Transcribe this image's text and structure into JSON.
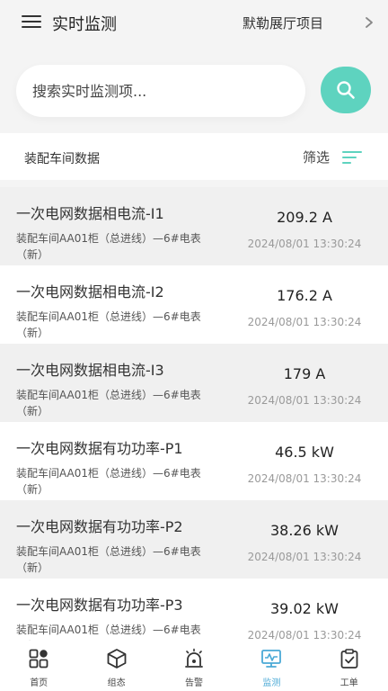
{
  "header": {
    "title": "实时监测",
    "project": "默勒展厅项目"
  },
  "search": {
    "placeholder": "搜索实时监测项..."
  },
  "section": {
    "title": "装配车间数据",
    "filter_label": "筛选"
  },
  "rows": [
    {
      "name": "一次电网数据相电流-I1",
      "location": "装配车间AA01柜（总进线）—6#电表（新）",
      "value": "209.2 A",
      "time": "2024/08/01 13:30:24"
    },
    {
      "name": "一次电网数据相电流-I2",
      "location": "装配车间AA01柜（总进线）—6#电表（新）",
      "value": "176.2 A",
      "time": "2024/08/01 13:30:24"
    },
    {
      "name": "一次电网数据相电流-I3",
      "location": "装配车间AA01柜（总进线）—6#电表（新）",
      "value": "179 A",
      "time": "2024/08/01 13:30:24"
    },
    {
      "name": "一次电网数据有功功率-P1",
      "location": "装配车间AA01柜（总进线）—6#电表（新）",
      "value": "46.5 kW",
      "time": "2024/08/01 13:30:24"
    },
    {
      "name": "一次电网数据有功功率-P2",
      "location": "装配车间AA01柜（总进线）—6#电表（新）",
      "value": "38.26 kW",
      "time": "2024/08/01 13:30:24"
    },
    {
      "name": "一次电网数据有功功率-P3",
      "location": "装配车间AA01柜（总进线）—6#电表（新）",
      "value": "39.02 kW",
      "time": "2024/08/01 13:30:24"
    }
  ],
  "tabs": [
    {
      "label": "首页",
      "icon": "home-grid-icon"
    },
    {
      "label": "组态",
      "icon": "cube-icon"
    },
    {
      "label": "告警",
      "icon": "alarm-light-icon"
    },
    {
      "label": "监测",
      "icon": "monitor-icon",
      "active": true
    },
    {
      "label": "工单",
      "icon": "clipboard-check-icon"
    }
  ],
  "colors": {
    "accent": "#5ed3bf",
    "active_tab": "#4aa9d6",
    "filter_icon": "#5ed3bf"
  }
}
